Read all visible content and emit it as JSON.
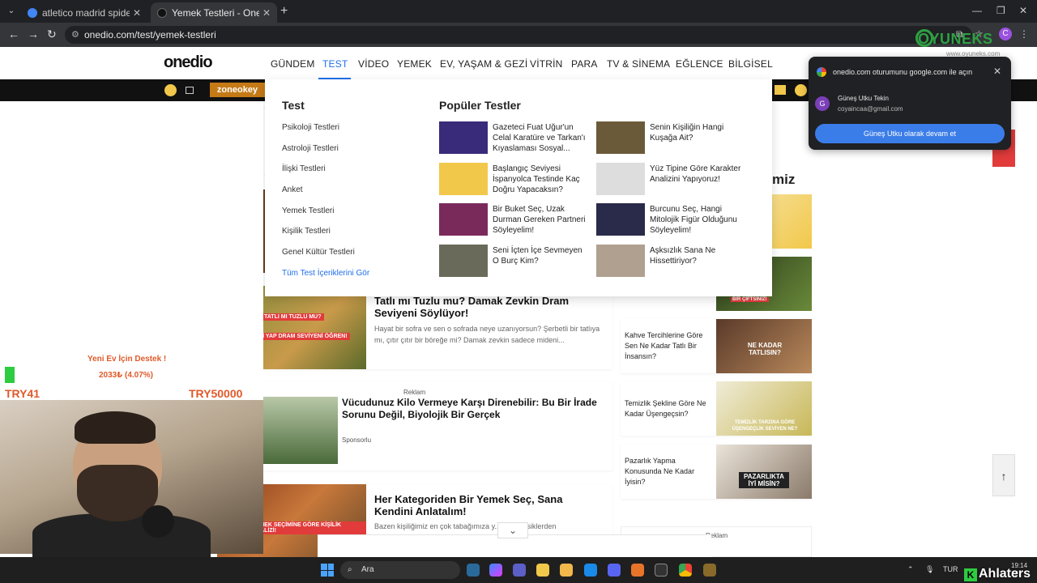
{
  "browser": {
    "tabs": [
      {
        "title": "atletico madrid spiderman forma",
        "favicon_color": "#4285f4"
      },
      {
        "title": "Yemek Testleri - Onedio",
        "favicon_color": "#111111"
      }
    ],
    "url": "onedio.com/test/yemek-testleri",
    "profile_initial": "C"
  },
  "site": {
    "logo": "onedio",
    "nav": [
      "GÜNDEM",
      "TEST",
      "VİDEO",
      "YEMEK",
      "EV, YAŞAM & GEZİ",
      "VİTRİN",
      "PARA",
      "TV & SİNEMA",
      "EĞLENCE",
      "BİLGİSEL"
    ],
    "active_nav": "TEST",
    "promo_label": "zoneokey"
  },
  "mega_menu": {
    "test_heading": "Test",
    "test_links": [
      "Psikoloji Testleri",
      "Astroloji Testleri",
      "İlişki Testleri",
      "Anket",
      "Yemek Testleri",
      "Kişilik Testleri",
      "Genel Kültür Testleri"
    ],
    "all_link": "Tüm Test İçeriklerini Gör",
    "popular_heading": "Popüler Testler",
    "popular": [
      {
        "title": "Gazeteci Fuat Uğur'un Celal Karatüre ve Tarkan'ı Kıyaslaması Sosyal...",
        "color": "#3a2a7a"
      },
      {
        "title": "Senin Kişiliğin Hangi Kuşağa Ait?",
        "color": "#6b5a3a"
      },
      {
        "title": "Başlangıç Seviyesi İspanyolca Testinde Kaç Doğru Yapacaksın?",
        "color": "#f2c84b"
      },
      {
        "title": "Yüz Tipine Göre Karakter Analizini Yapıyoruz!",
        "color": "#dddddd"
      },
      {
        "title": "Bir Buket Seç, Uzak Durman Gereken Partneri Söyleyelim!",
        "color": "#7a2a5a"
      },
      {
        "title": "Burcunu Seç, Hangi Mitolojik Figür Olduğunu Söyleyelim!",
        "color": "#2a2a4a"
      },
      {
        "title": "Seni İçten İçe Sevmeyen O Burç Kim?",
        "color": "#6a6a5a"
      },
      {
        "title": "Aşksızlık Sana Ne Hissettiriyor?",
        "color": "#b0a090"
      }
    ]
  },
  "articles": [
    {
      "title": "Tatlı mı Tuzlu mu? Damak Zevkin Dram Seviyeni Söylüyor!",
      "desc": "Hayat bir sofra ve sen o sofrada neye uzanıyorsun? Şerbetli bir tatlıya mı, çıtır çıtır bir böreğe mi? Damak zevkin sadece mideni...",
      "thumb_color": "#6a7a3a",
      "thumb_text_1": "TATLI MI TUZLU MU?",
      "thumb_text_2": "SEÇİMİNİ YAP DRAM SEVİYENİ ÖĞREN!"
    },
    {
      "title": "Vücudunuz Kilo Vermeye Karşı Direnebilir: Bu Bir İrade Sorunu Değil, Biyolojik Bir Gerçek",
      "sponsor": "Sponsorlu",
      "reklam": "Reklam",
      "thumb_color": "#4a6a3a"
    },
    {
      "title": "Her Kategoriden Bir Yemek Seç, Sana Kendini Anlatalım!",
      "desc": "Bazen kişiliğimiz en çok tabağımıza y... imiz klasiklerden",
      "thumb_color": "#8a4a2a",
      "thumb_text": "YEMEK SEÇİMİNE GÖRE KİŞİLİK ANALİZİ!"
    }
  ],
  "sidebar": {
    "heading_fragment": "miz",
    "items": [
      {
        "title": "Kahve Tercihlerine Göre Sen Ne Kadar Tatlı Bir İnsansın?",
        "thumb_text": "NE KADAR TATLISIN?",
        "color": "#8a6a4a"
      },
      {
        "title": "Temizlik Şekline Göre Ne Kadar Üşengeçsin?",
        "thumb_text": "TEMİZLİK TARZINA GÖRE ÜŞENGEÇLİK SEVİYEN NE?",
        "color": "#c8b878"
      },
      {
        "title": "Pazarlık Yapma Konusunda Ne Kadar İyisin?",
        "thumb_text": "PAZARLIKTA İYİ MİSİN?",
        "color": "#9a8a7a"
      }
    ],
    "top_thumb_color": "#f2c84b",
    "second_thumb_color": "#3a5a2a",
    "second_thumb_text": "BİR ÇİFTSİNİZ!",
    "reklam": "Reklam"
  },
  "google_prompt": {
    "title": "onedio.com oturumunu google.com ile açın",
    "user_initial": "G",
    "user_name": "Güneş Utku Tekin",
    "email": "coyaincaa@gmail.com",
    "button": "Güneş Utku olarak devam et"
  },
  "stream": {
    "donate_title": "Yeni Ev İçin Destek !",
    "donate_amount": "2033₺ (4.07%)",
    "donate_progress": 0.0407,
    "try_left": "TRY41",
    "try_right": "TRY50000",
    "brand": "OYUNEKS",
    "brand_sub": "www.oyuneks.com",
    "corner_brand": "Ahlaters"
  },
  "taskbar": {
    "search": "Ara",
    "lang": "TUR",
    "time": "19:14",
    "date_fragment": "12"
  }
}
